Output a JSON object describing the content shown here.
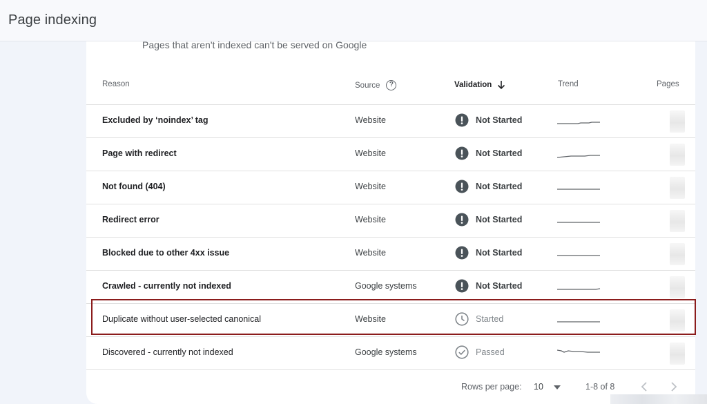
{
  "header": {
    "title": "Page indexing"
  },
  "card": {
    "subtitle": "Pages that aren't indexed can't be served on Google",
    "columns": {
      "reason": "Reason",
      "source": "Source",
      "validation": "Validation",
      "trend": "Trend",
      "pages": "Pages"
    },
    "icons": {
      "source_help": "help-circle-icon",
      "validation_sort": "arrow-down-icon",
      "not_started": "exclamation-circle-icon",
      "started": "clock-icon",
      "passed": "check-circle-icon"
    },
    "rows": [
      {
        "reason": "Excluded by ‘noindex’ tag",
        "source": "Website",
        "validation": "Not Started",
        "status": "not_started"
      },
      {
        "reason": "Page with redirect",
        "source": "Website",
        "validation": "Not Started",
        "status": "not_started"
      },
      {
        "reason": "Not found (404)",
        "source": "Website",
        "validation": "Not Started",
        "status": "not_started"
      },
      {
        "reason": "Redirect error",
        "source": "Website",
        "validation": "Not Started",
        "status": "not_started"
      },
      {
        "reason": "Blocked due to other 4xx issue",
        "source": "Website",
        "validation": "Not Started",
        "status": "not_started"
      },
      {
        "reason": "Crawled - currently not indexed",
        "source": "Google systems",
        "validation": "Not Started",
        "status": "not_started"
      },
      {
        "reason": "Duplicate without user-selected canonical",
        "source": "Website",
        "validation": "Started",
        "status": "started"
      },
      {
        "reason": "Discovered - currently not indexed",
        "source": "Google systems",
        "validation": "Passed",
        "status": "passed"
      }
    ],
    "highlighted_row": 7
  },
  "footer": {
    "rows_per_page_label": "Rows per page:",
    "rows_per_page_value": "10",
    "range": "1-8 of 8",
    "icons": {
      "rows_caret": "caret-down-icon",
      "prev": "chevron-left-icon",
      "next": "chevron-right-icon"
    }
  },
  "colors": {
    "status_icon_dark": "#4a5359",
    "muted_icon": "#80868b",
    "highlight_border": "#8b1c1c",
    "trend_line": "#5f6368"
  }
}
